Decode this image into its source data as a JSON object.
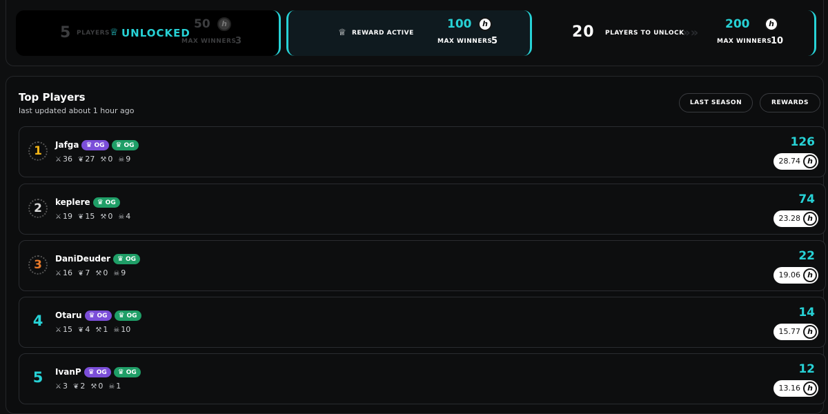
{
  "tiers": [
    {
      "players": "5",
      "players_label": "PLAYERS",
      "status": "UNLOCKED",
      "reward": "50",
      "coin": "h",
      "max_label": "MAX WINNERS",
      "max_value": "3"
    },
    {
      "status": "REWARD ACTIVE",
      "reward": "100",
      "coin": "h",
      "max_label": "MAX WINNERS",
      "max_value": "5"
    },
    {
      "players": "20",
      "players_label": "PLAYERS TO UNLOCK",
      "reward": "200",
      "coin": "h",
      "max_label": "MAX WINNERS",
      "max_value": "10"
    }
  ],
  "leaderboard": {
    "title": "Top Players",
    "subtitle": "last updated about 1 hour ago",
    "buttons": {
      "last_season": "LAST SEASON",
      "rewards": "REWARDS"
    },
    "badge_label": "OG",
    "rows": [
      {
        "rank": "1",
        "name": "Jafga",
        "badges": [
          "purple",
          "green"
        ],
        "kills": "36",
        "wins": "27",
        "s3": "0",
        "s4": "9",
        "score": "126",
        "reward": "28.74"
      },
      {
        "rank": "2",
        "name": "keplere",
        "badges": [
          "green"
        ],
        "kills": "19",
        "wins": "15",
        "s3": "0",
        "s4": "4",
        "score": "74",
        "reward": "23.28"
      },
      {
        "rank": "3",
        "name": "DaniDeuder",
        "badges": [
          "green"
        ],
        "kills": "16",
        "wins": "7",
        "s3": "0",
        "s4": "9",
        "score": "22",
        "reward": "19.06"
      },
      {
        "rank": "4",
        "name": "Otaru",
        "badges": [
          "purple",
          "green"
        ],
        "kills": "15",
        "wins": "4",
        "s3": "1",
        "s4": "10",
        "score": "14",
        "reward": "15.77"
      },
      {
        "rank": "5",
        "name": "IvanP",
        "badges": [
          "purple",
          "green"
        ],
        "kills": "3",
        "wins": "2",
        "s3": "0",
        "s4": "1",
        "score": "12",
        "reward": "13.16"
      }
    ]
  },
  "icons": {
    "kills": "swords-icon",
    "wins": "laurel-icon",
    "s3": "hammer-icon",
    "s4": "skull-icon",
    "crown": "crown-icon",
    "trophy": "trophy-icon"
  },
  "colors": {
    "accent": "#27d2d6",
    "og_purple": "#7b4ed8",
    "og_green": "#1f9e67",
    "gold": "#f2b417",
    "bronze": "#e87a2a"
  }
}
